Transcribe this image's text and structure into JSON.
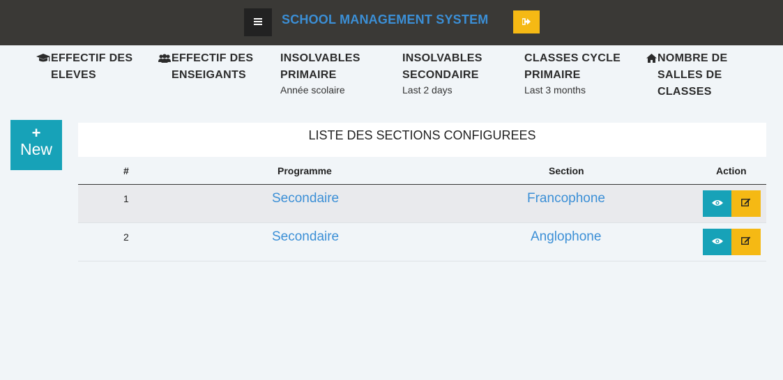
{
  "header": {
    "title": "SCHOOL MANAGEMENT SYSTEM",
    "menu_icon": "hamburger-icon",
    "logout_icon": "sign-out-icon"
  },
  "stats": [
    {
      "label_line1": "EFFECTIF DES",
      "label_line2": "ELEVES",
      "icon": "graduation-cap-icon"
    },
    {
      "label_line1": "EFFECTIF DES",
      "label_line2": "ENSEIGANTS",
      "icon": "users-icon"
    },
    {
      "label_line1": "INSOLVABLES",
      "label_line2": "PRIMAIRE",
      "sub": "Année scolaire"
    },
    {
      "label_line1": "INSOLVABLES",
      "label_line2": "SECONDAIRE",
      "sub": "Last 2 days"
    },
    {
      "label_line1": "CLASSES CYCLE",
      "label_line2": "PRIMAIRE",
      "sub": "Last 3 months"
    },
    {
      "label_line1": "NOMBRE DE",
      "label_line2": "SALLES DE",
      "label_line3": "CLASSES",
      "icon": "home-icon"
    }
  ],
  "new_button": {
    "plus": "+",
    "label": "New"
  },
  "table": {
    "title": "LISTE DES SECTIONS CONFIGUREES",
    "headers": {
      "num": "#",
      "programme": "Programme",
      "section": "Section",
      "action": "Action"
    },
    "rows": [
      {
        "num": "1",
        "programme": "Secondaire",
        "section": "Francophone"
      },
      {
        "num": "2",
        "programme": "Secondaire",
        "section": "Anglophone"
      }
    ]
  },
  "colors": {
    "topbar": "#3a3936",
    "title": "#3b8fd6",
    "info": "#17a2b8",
    "warning": "#f5b914",
    "link": "#3b8fd6"
  }
}
